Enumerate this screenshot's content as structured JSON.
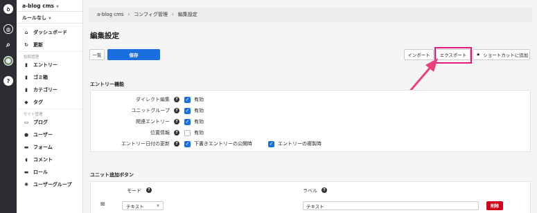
{
  "sidebar": {
    "site_name": "a-blog cms",
    "rule_label": "ルールなし",
    "items_top": [
      {
        "label": "ダッシュボード",
        "icon": "home-icon"
      },
      {
        "label": "更新",
        "icon": "refresh-icon"
      }
    ],
    "section_entries": "投稿管理",
    "items_entries": [
      {
        "label": "エントリー",
        "icon": "document-icon"
      },
      {
        "label": "ゴミ箱",
        "icon": "trash-icon"
      },
      {
        "label": "カテゴリー",
        "icon": "folder-icon"
      },
      {
        "label": "タグ",
        "icon": "tag-icon"
      }
    ],
    "section_site": "サイト管理",
    "items_site": [
      {
        "label": "ブログ",
        "icon": "blog-icon"
      },
      {
        "label": "ユーザー",
        "icon": "user-icon"
      },
      {
        "label": "フォーム",
        "icon": "form-icon"
      },
      {
        "label": "コメント",
        "icon": "comment-icon"
      },
      {
        "label": "ロール",
        "icon": "role-icon"
      },
      {
        "label": "ユーザーグループ",
        "icon": "group-icon"
      }
    ]
  },
  "breadcrumb": {
    "home": "a-blog cms",
    "config": "コンフィグ管理",
    "current": "編集設定"
  },
  "page_title": "編集設定",
  "toolbar": {
    "list_label": "一覧",
    "save_label": "保存",
    "import_label": "インポート",
    "export_label": "エクスポート",
    "shortcut_label": "ショートカットに追加"
  },
  "entry_features": {
    "title": "エントリー機能",
    "rows": [
      {
        "label": "ダイレクト編集",
        "option": "有効",
        "checked": true
      },
      {
        "label": "ユニットグループ",
        "option": "有効",
        "checked": true
      },
      {
        "label": "関連エントリー",
        "option": "有効",
        "checked": true
      },
      {
        "label": "位置情報",
        "option": "有効",
        "checked": false
      }
    ],
    "date_update": {
      "label": "エントリー日付の更新",
      "option1": "下書きエントリーの公開時",
      "option2": "エントリーの複製時"
    }
  },
  "unit_buttons": {
    "title": "ユニット追加ボタン",
    "mode_header": "モード",
    "label_header": "ラベル",
    "row": {
      "mode_value": "テキスト",
      "label_value": "テキスト",
      "delete_label": "削除"
    }
  },
  "colors": {
    "primary": "#1a6fe0",
    "danger": "#d0021b",
    "highlight": "#e0197c",
    "rail": "#2b2d33"
  }
}
